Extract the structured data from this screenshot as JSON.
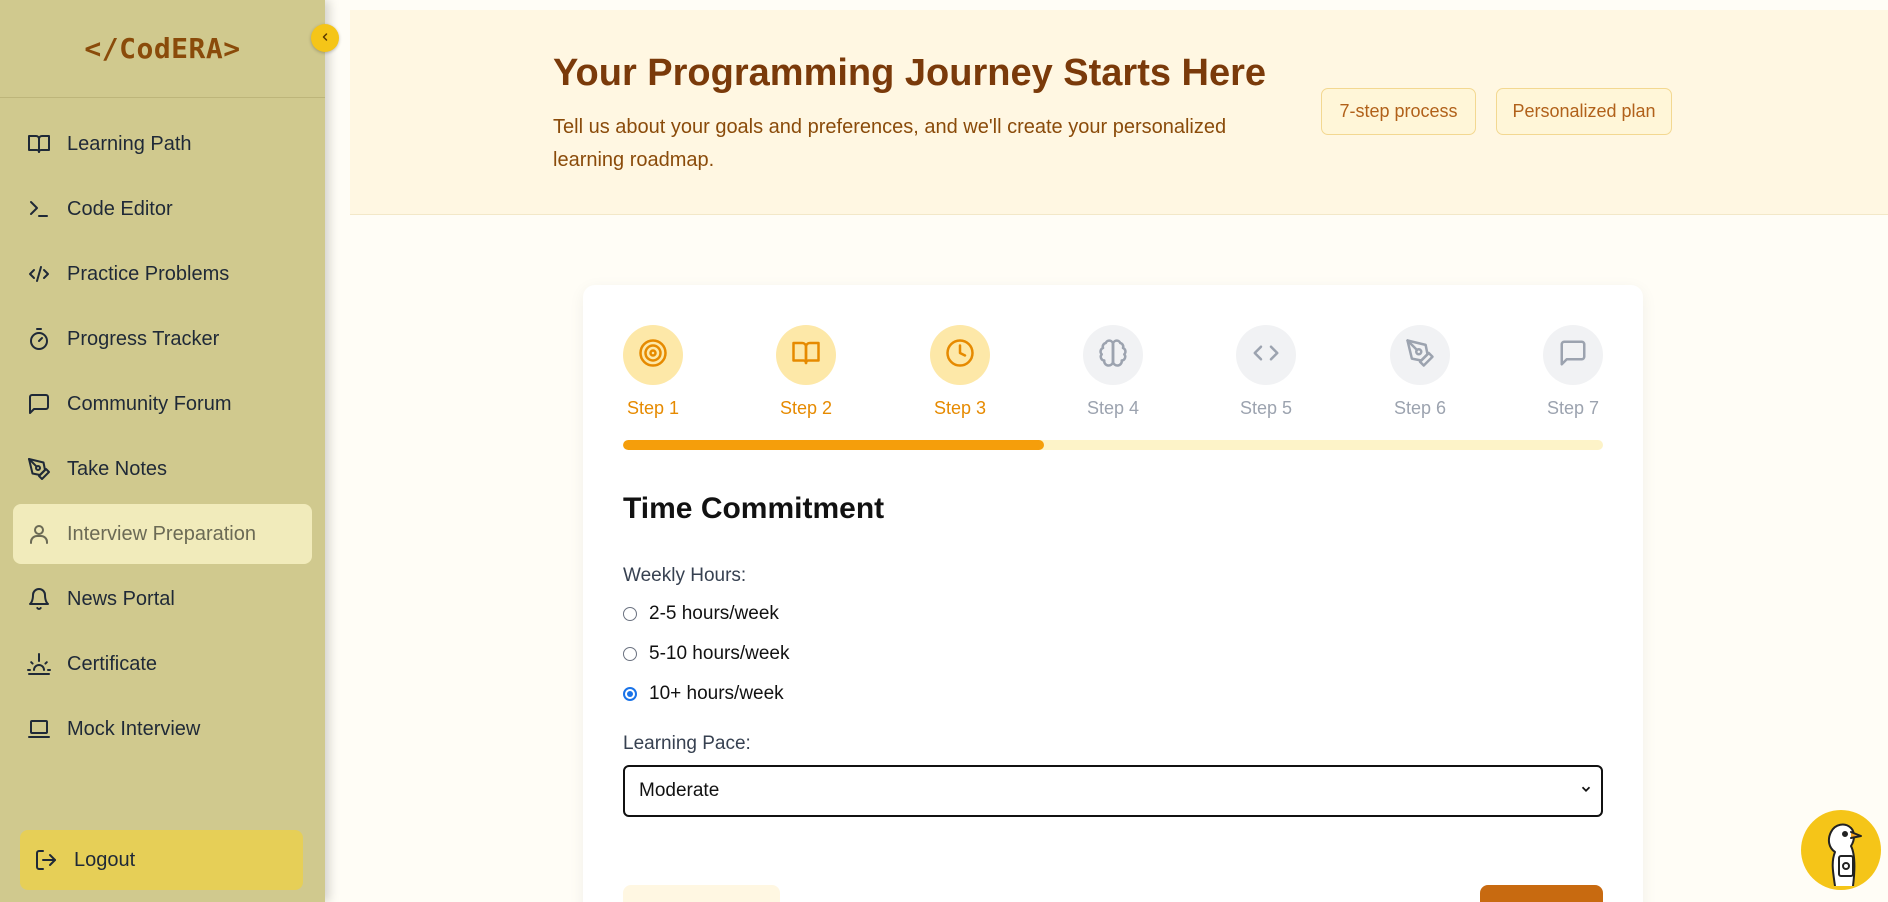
{
  "brand": {
    "logo_text": "</CodERA>"
  },
  "sidebar": {
    "collapse_icon": "chevron-left-icon",
    "items": [
      {
        "label": "Learning Path",
        "icon": "book-open-icon",
        "active": false
      },
      {
        "label": "Code Editor",
        "icon": "terminal-icon",
        "active": false
      },
      {
        "label": "Practice Problems",
        "icon": "code-icon",
        "active": false
      },
      {
        "label": "Progress Tracker",
        "icon": "timer-icon",
        "active": false
      },
      {
        "label": "Community Forum",
        "icon": "message-square-icon",
        "active": false
      },
      {
        "label": "Take Notes",
        "icon": "pen-tool-icon",
        "active": false
      },
      {
        "label": "Interview Preparation",
        "icon": "user-icon",
        "active": true
      },
      {
        "label": "News Portal",
        "icon": "bell-icon",
        "active": false
      },
      {
        "label": "Certificate",
        "icon": "sunrise-icon",
        "active": false
      },
      {
        "label": "Mock Interview",
        "icon": "laptop-icon",
        "active": false
      }
    ],
    "logout_label": "Logout"
  },
  "hero": {
    "title": "Your Programming Journey Starts Here",
    "subtitle": "Tell us about your goals and preferences, and we'll create your personalized learning roadmap.",
    "chips": [
      "7-step process",
      "Personalized plan"
    ]
  },
  "stepper": {
    "steps": [
      {
        "label": "Step 1",
        "icon": "target-icon",
        "state": "done"
      },
      {
        "label": "Step 2",
        "icon": "book-open-icon",
        "state": "done"
      },
      {
        "label": "Step 3",
        "icon": "clock-icon",
        "state": "done"
      },
      {
        "label": "Step 4",
        "icon": "brain-icon",
        "state": "todo"
      },
      {
        "label": "Step 5",
        "icon": "code-icon",
        "state": "todo"
      },
      {
        "label": "Step 6",
        "icon": "pen-tool-icon",
        "state": "todo"
      },
      {
        "label": "Step 7",
        "icon": "message-square-icon",
        "state": "todo"
      }
    ],
    "progress_fraction": 0.43
  },
  "form": {
    "section_title": "Time Commitment",
    "weekly_label": "Weekly Hours:",
    "weekly_options": [
      {
        "label": "2-5 hours/week",
        "checked": false
      },
      {
        "label": "5-10 hours/week",
        "checked": false
      },
      {
        "label": "10+ hours/week",
        "checked": true
      }
    ],
    "pace_label": "Learning Pace:",
    "pace_value": "Moderate"
  },
  "colors": {
    "sidebar_bg": "#d0c98e",
    "accent": "#f59e0b",
    "title": "#7a3a0a",
    "active_item": "#f1ebbb",
    "logout_bg": "#e6cf57"
  }
}
